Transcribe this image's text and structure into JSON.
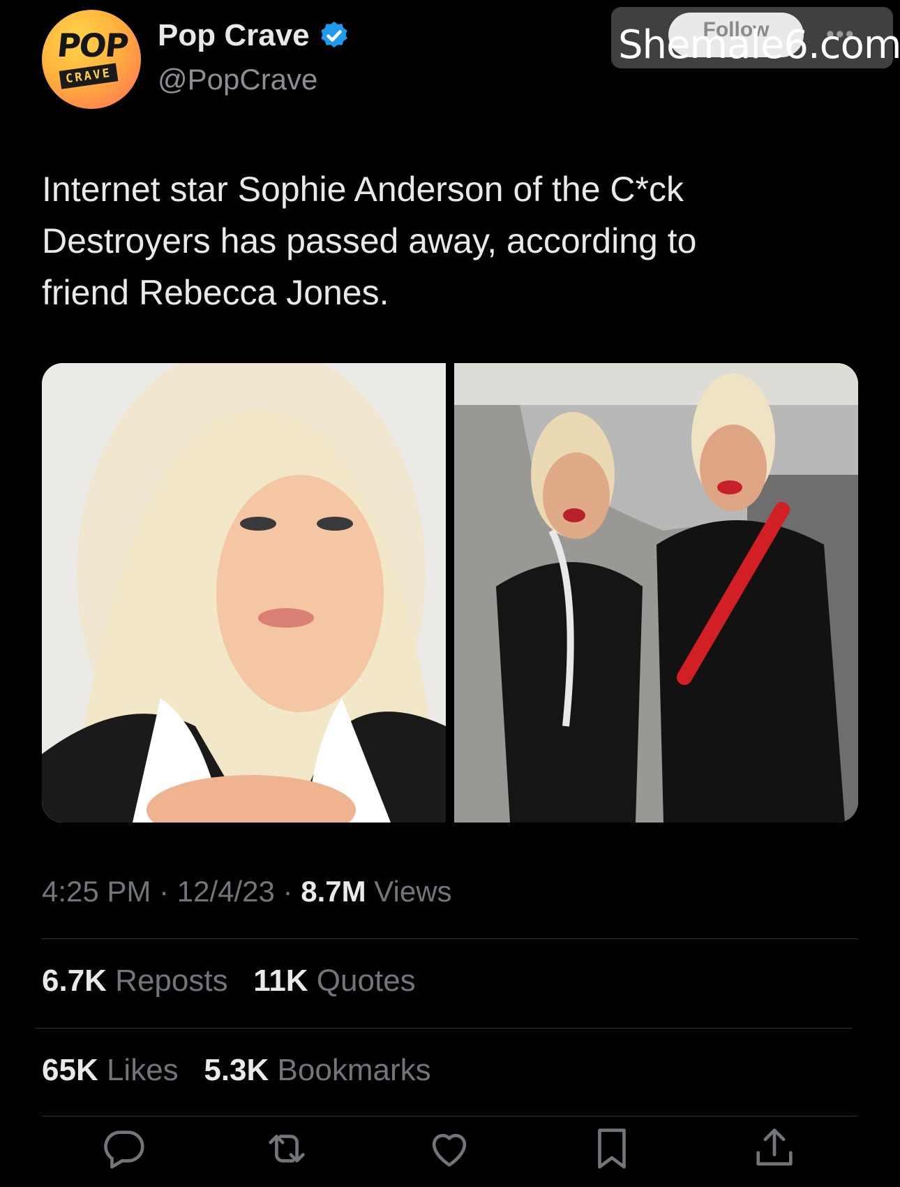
{
  "header": {
    "display_name": "Pop Crave",
    "handle": "@PopCrave",
    "avatar_text_top": "POP",
    "avatar_text_bottom": "CRAVE",
    "follow_label": "Follow",
    "more_icon": "more-dots-icon",
    "verified_color": "#1d9bf0"
  },
  "watermark": "Shemale6.com",
  "tweet": {
    "text_line1": "Internet star Sophie Anderson of the C*ck",
    "text_line2": "Destroyers has passed away, according to",
    "text_line3": "friend Rebecca Jones."
  },
  "meta": {
    "time": "4:25 PM",
    "sep1": " · ",
    "date": "12/4/23",
    "sep2": " · ",
    "views_count": "8.7M",
    "views_label": " Views"
  },
  "stats": {
    "reposts_count": "6.7K",
    "reposts_label": " Reposts",
    "quotes_count": "11K",
    "quotes_label": " Quotes",
    "likes_count": "65K",
    "likes_label": " Likes",
    "bookmarks_count": "5.3K",
    "bookmarks_label": " Bookmarks"
  },
  "actions": [
    "reply-icon",
    "repost-icon",
    "like-icon",
    "bookmark-icon",
    "share-icon"
  ],
  "colors": {
    "background": "#000000",
    "text": "#e7e9ea",
    "muted": "#71767b",
    "accent": "#1d9bf0"
  }
}
